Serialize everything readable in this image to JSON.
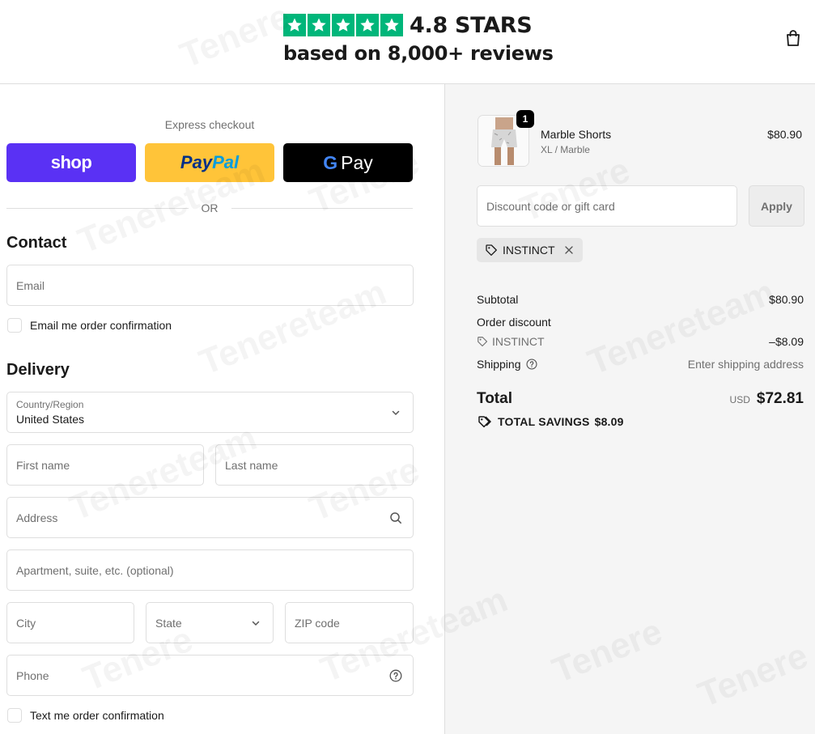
{
  "header": {
    "rating": "4.8 STARS",
    "reviews": "based on 8,000+ reviews",
    "star_color": "#00b67a",
    "cart_icon": "shopping-bag-icon"
  },
  "express": {
    "label": "Express checkout",
    "shop_label": "shop",
    "paypal_part1": "Pay",
    "paypal_part2": "Pal",
    "gpay_g": "G",
    "gpay_label": "Pay",
    "or_label": "OR"
  },
  "contact": {
    "title": "Contact",
    "email_placeholder": "Email",
    "email_opt_in": "Email me order confirmation"
  },
  "delivery": {
    "title": "Delivery",
    "country_label": "Country/Region",
    "country_value": "United States",
    "first_name_placeholder": "First name",
    "last_name_placeholder": "Last name",
    "address_placeholder": "Address",
    "apartment_placeholder": "Apartment, suite, etc. (optional)",
    "city_placeholder": "City",
    "state_placeholder": "State",
    "zip_placeholder": "ZIP code",
    "phone_placeholder": "Phone",
    "text_opt_in": "Text me order confirmation"
  },
  "order": {
    "item": {
      "name": "Marble Shorts",
      "variant": "XL / Marble",
      "price": "$80.90",
      "quantity": "1"
    },
    "discount_placeholder": "Discount code or gift card",
    "apply_label": "Apply",
    "applied_code": "INSTINCT",
    "subtotal_label": "Subtotal",
    "subtotal_value": "$80.90",
    "order_discount_label": "Order discount",
    "discount_code": "INSTINCT",
    "discount_value": "–$8.09",
    "shipping_label": "Shipping",
    "shipping_value": "Enter shipping address",
    "total_label": "Total",
    "currency": "USD",
    "total_value": "$72.81",
    "savings_label": "TOTAL SAVINGS",
    "savings_value": "$8.09"
  },
  "colors": {
    "shop_purple": "#5a31f4",
    "paypal_yellow": "#ffc439",
    "gpay_black": "#000000",
    "summary_bg": "#f5f5f5"
  }
}
